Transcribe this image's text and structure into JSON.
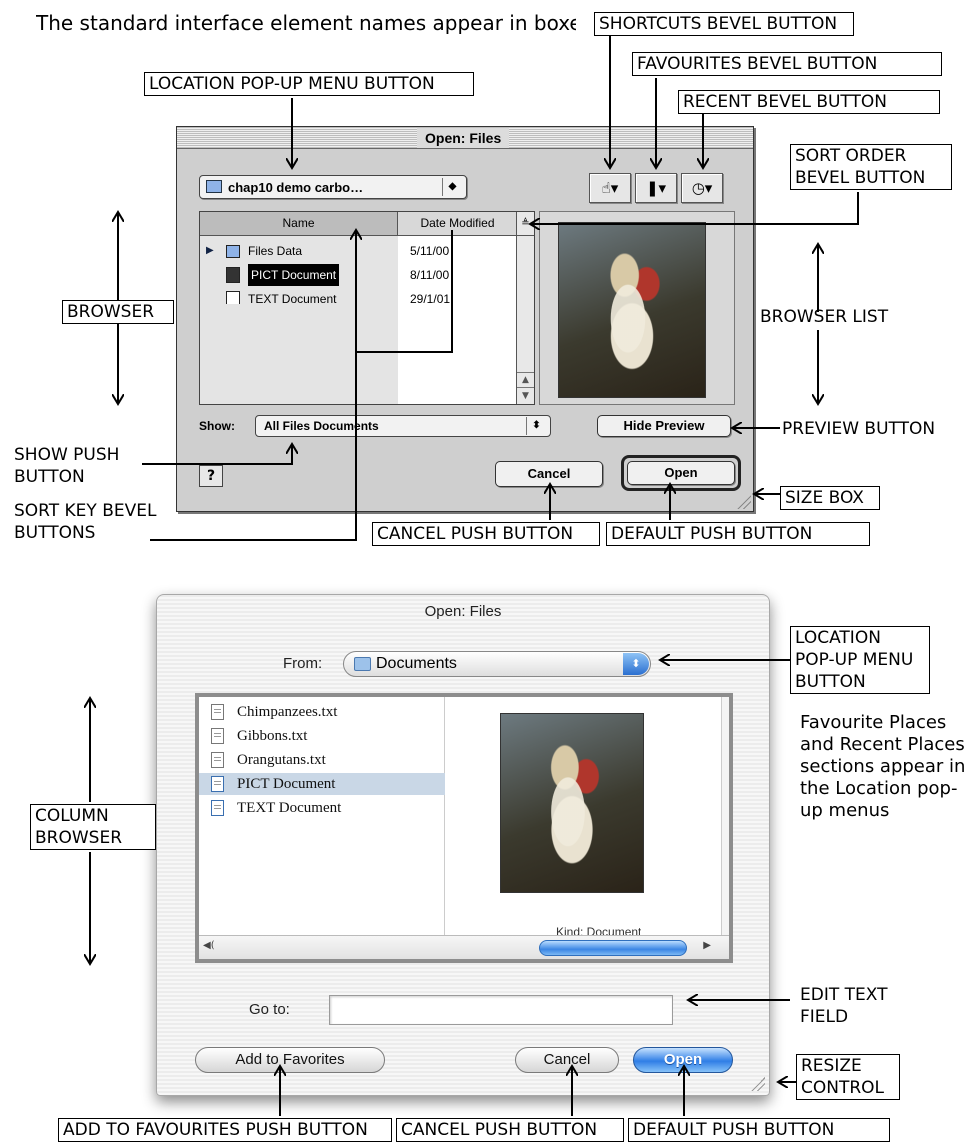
{
  "caption": "The standard interface element names appear in boxes.",
  "classic": {
    "title": "Open: Files",
    "location_popup": "chap10 demo carbo…",
    "popup_arrow": "◆",
    "shortcuts_glyph": "☝",
    "favourites_glyph": "❚",
    "recent_glyph": "◷",
    "col_name": "Name",
    "col_date": "Date Modified",
    "rows": [
      {
        "name": "Files Data",
        "date": "5/11/00"
      },
      {
        "name": "PICT Document",
        "date": "8/11/00"
      },
      {
        "name": "TEXT Document",
        "date": "29/1/01"
      }
    ],
    "show_label": "Show:",
    "show_value": "All Files Documents",
    "show_arrow": "⬍",
    "hide_preview": "Hide Preview",
    "help": "?",
    "cancel": "Cancel",
    "open": "Open"
  },
  "aqua": {
    "title": "Open: Files",
    "from_label": "From:",
    "from_value": "Documents",
    "from_arrow": "⬍",
    "files": [
      "Chimpanzees.txt",
      "Gibbons.txt",
      "Orangutans.txt",
      "PICT Document",
      "TEXT Document"
    ],
    "preview_caption": "Kind: Document",
    "goto_label": "Go to:",
    "goto_value": "",
    "add_to_favorites": "Add to Favorites",
    "cancel": "Cancel",
    "open": "Open"
  },
  "annotations": {
    "shortcuts": "SHORTCUTS BEVEL BUTTON",
    "favourites": "FAVOURITES BEVEL BUTTON",
    "location": "LOCATION POP-UP MENU BUTTON",
    "recent": "RECENT BEVEL BUTTON",
    "sort_order": "SORT ORDER BEVEL BUTTON",
    "browser": "BROWSER",
    "browser_list": "BROWSER LIST",
    "preview_button": "PREVIEW BUTTON",
    "show_push": "SHOW PUSH BUTTON",
    "sort_key": "SORT KEY BEVEL BUTTONS",
    "size_box": "SIZE BOX",
    "cancel_push": "CANCEL PUSH BUTTON",
    "default_push": "DEFAULT PUSH BUTTON",
    "location2": "LOCATION POP-UP MENU BUTTON",
    "note": "Favourite Places and Recent Places sections appear in the Location pop-up menus",
    "column_browser": "COLUMN BROWSER",
    "edit_text": "EDIT TEXT FIELD",
    "resize": "RESIZE CONTROL",
    "add_fav": "ADD TO FAVOURITES PUSH BUTTON",
    "cancel_push2": "CANCEL PUSH BUTTON",
    "default_push2": "DEFAULT PUSH BUTTON"
  },
  "colors": {
    "aqua_default": "#2f7ee6",
    "selection_row": "#c9d7e6",
    "classic_face": "#cfcfcf"
  }
}
